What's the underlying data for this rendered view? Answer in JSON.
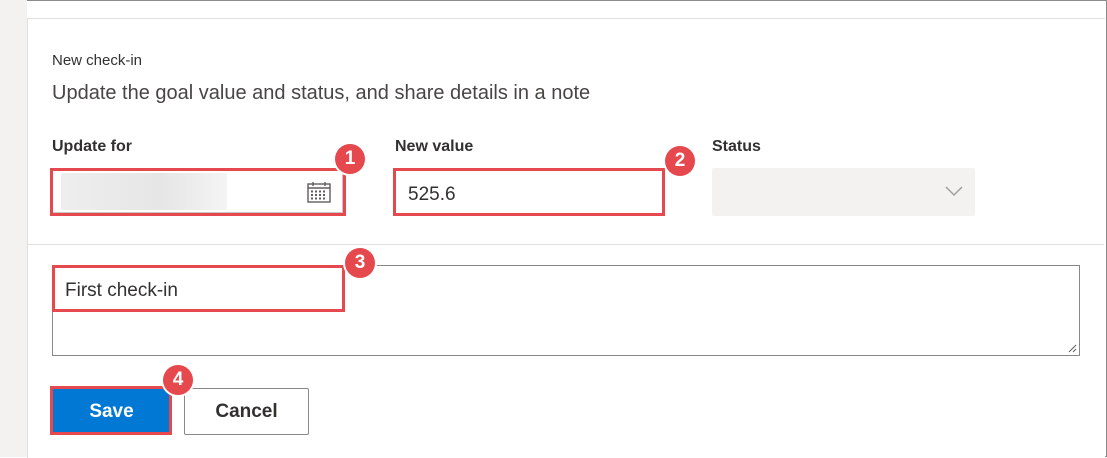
{
  "form": {
    "kicker": "New check-in",
    "subtitle": "Update the goal value and status, and share details in a note",
    "update_for": {
      "label": "Update for"
    },
    "new_value": {
      "label": "New value",
      "value": "525.6"
    },
    "status": {
      "label": "Status",
      "selected": ""
    },
    "note": {
      "value": "First check-in"
    },
    "buttons": {
      "save": "Save",
      "cancel": "Cancel"
    }
  },
  "callouts": [
    "1",
    "2",
    "3",
    "4"
  ],
  "colors": {
    "accent": "#0078d4",
    "callout": "#e5484d",
    "field_border": "#c8c6c4",
    "select_bg": "#f3f2f1"
  },
  "icons": {
    "date_picker": "calendar-icon",
    "status_dropdown": "chevron-down-icon",
    "note_resize": "resize-grip-icon"
  }
}
